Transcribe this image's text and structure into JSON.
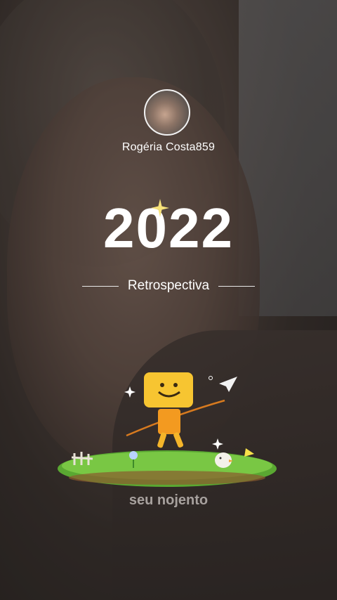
{
  "profile": {
    "username": "Rogéria Costa859",
    "avatar_icon": "user-avatar-icon"
  },
  "headline": {
    "year": "2022",
    "subtitle": "Retrospectiva"
  },
  "caption": "seu nojento",
  "colors": {
    "text": "#ffffff",
    "grass": "#6fbf3a",
    "mascot": "#f5b52a"
  }
}
